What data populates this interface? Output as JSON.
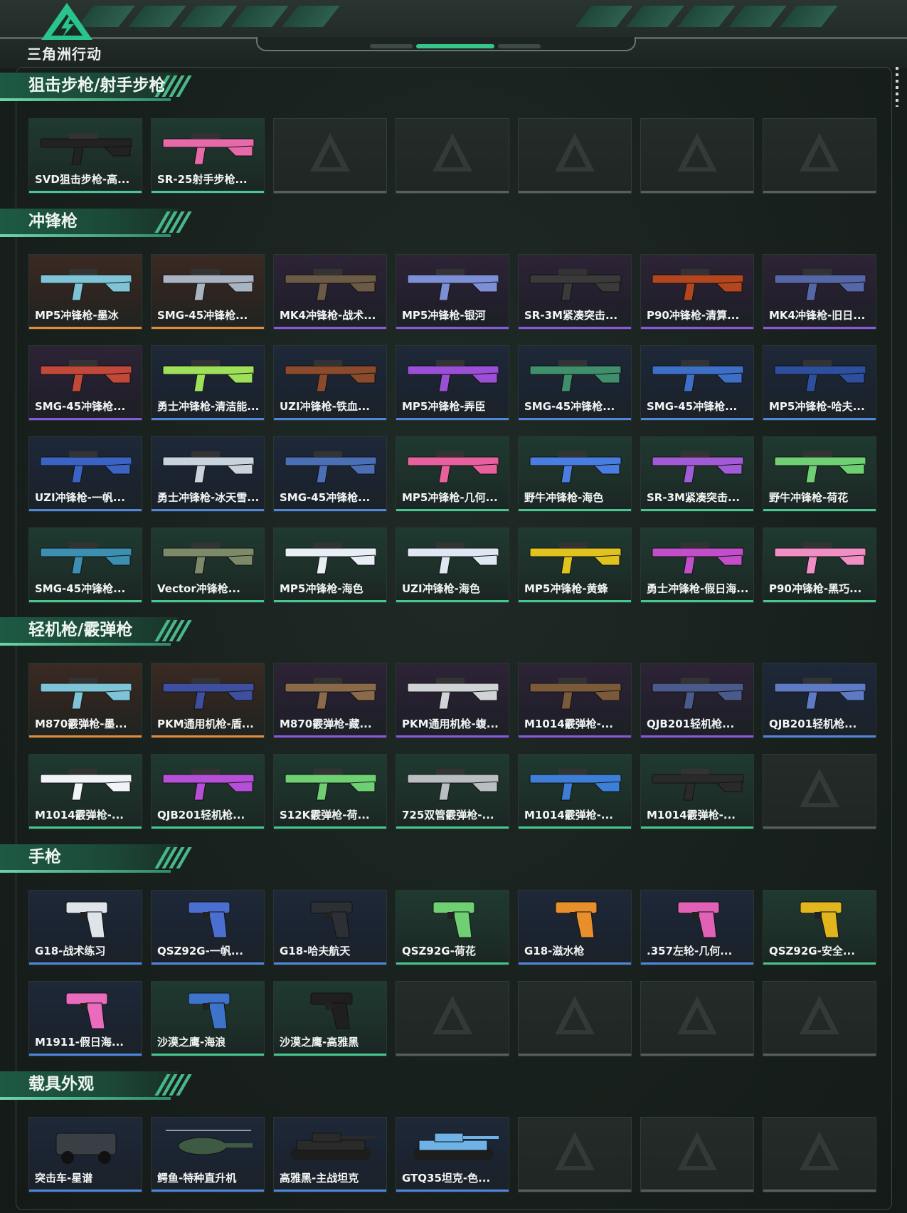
{
  "app": {
    "logo_text": "三角洲行动"
  },
  "colors": {
    "orange": "#e48a3b",
    "purple": "#8b56e0",
    "blue": "#4f86df",
    "green": "#43c98d"
  },
  "sections": [
    {
      "title": "狙击步枪/射手步枪",
      "rows": [
        [
          {
            "label": "SVD狙击步枪-高...",
            "rarity": "green",
            "icon": "sniper-rifle-icon",
            "hue": "#222"
          },
          {
            "label": "SR-25射手步枪...",
            "rarity": "green",
            "icon": "marksman-rifle-icon",
            "hue": "#e66aa8"
          },
          null,
          null,
          null,
          null,
          null
        ]
      ]
    },
    {
      "title": "冲锋枪",
      "rows": [
        [
          {
            "label": "MP5冲锋枪-墨冰",
            "rarity": "orange",
            "icon": "smg-icon",
            "hue": "#7fc4d6"
          },
          {
            "label": "SMG-45冲锋枪...",
            "rarity": "orange",
            "icon": "smg-icon",
            "hue": "#aab3c2"
          },
          {
            "label": "MK4冲锋枪-战术...",
            "rarity": "purple",
            "icon": "smg-icon",
            "hue": "#6b5a45"
          },
          {
            "label": "MP5冲锋枪-银河",
            "rarity": "purple",
            "icon": "smg-icon",
            "hue": "#7d8fd6"
          },
          {
            "label": "SR-3M紧凑突击...",
            "rarity": "purple",
            "icon": "smg-icon",
            "hue": "#3a3a3a"
          },
          {
            "label": "P90冲锋枪-清算...",
            "rarity": "purple",
            "icon": "smg-icon",
            "hue": "#b3451f"
          },
          {
            "label": "MK4冲锋枪-旧日...",
            "rarity": "purple",
            "icon": "smg-icon",
            "hue": "#5667a8"
          }
        ],
        [
          {
            "label": "SMG-45冲锋枪...",
            "rarity": "purple",
            "icon": "smg-icon",
            "hue": "#c2483a"
          },
          {
            "label": "勇士冲锋枪-清洁能...",
            "rarity": "blue",
            "icon": "smg-icon",
            "hue": "#9ee05a"
          },
          {
            "label": "UZI冲锋枪-铁血...",
            "rarity": "blue",
            "icon": "smg-icon",
            "hue": "#8a4a2b"
          },
          {
            "label": "MP5冲锋枪-弄臣",
            "rarity": "blue",
            "icon": "smg-icon",
            "hue": "#9b4fd6"
          },
          {
            "label": "SMG-45冲锋枪...",
            "rarity": "blue",
            "icon": "smg-icon",
            "hue": "#3f8f6d"
          },
          {
            "label": "SMG-45冲锋枪...",
            "rarity": "blue",
            "icon": "smg-icon",
            "hue": "#3d6fc7"
          },
          {
            "label": "MP5冲锋枪-哈夫...",
            "rarity": "blue",
            "icon": "smg-icon",
            "hue": "#2e4f9e"
          }
        ],
        [
          {
            "label": "UZI冲锋枪-一帆...",
            "rarity": "blue",
            "icon": "smg-icon",
            "hue": "#3b63c4"
          },
          {
            "label": "勇士冲锋枪-冰天雪...",
            "rarity": "blue",
            "icon": "smg-icon",
            "hue": "#c9d3dc"
          },
          {
            "label": "SMG-45冲锋枪...",
            "rarity": "blue",
            "icon": "smg-icon",
            "hue": "#4a6fb5"
          },
          {
            "label": "MP5冲锋枪-几何...",
            "rarity": "green",
            "icon": "smg-icon",
            "hue": "#e8619f"
          },
          {
            "label": "野牛冲锋枪-海色",
            "rarity": "green",
            "icon": "smg-icon",
            "hue": "#4a7de0"
          },
          {
            "label": "SR-3M紧凑突击...",
            "rarity": "green",
            "icon": "smg-icon",
            "hue": "#a15bd6"
          },
          {
            "label": "野牛冲锋枪-荷花",
            "rarity": "green",
            "icon": "smg-icon",
            "hue": "#6fcf73"
          }
        ],
        [
          {
            "label": "SMG-45冲锋枪...",
            "rarity": "green",
            "icon": "smg-icon",
            "hue": "#3c8fb0"
          },
          {
            "label": "Vector冲锋枪...",
            "rarity": "green",
            "icon": "smg-icon",
            "hue": "#7d8a6a"
          },
          {
            "label": "MP5冲锋枪-海色",
            "rarity": "green",
            "icon": "smg-icon",
            "hue": "#e8eef5"
          },
          {
            "label": "UZI冲锋枪-海色",
            "rarity": "green",
            "icon": "smg-icon",
            "hue": "#dfe7f2"
          },
          {
            "label": "MP5冲锋枪-黄蜂",
            "rarity": "green",
            "icon": "smg-icon",
            "hue": "#e0c31e"
          },
          {
            "label": "勇士冲锋枪-假日海...",
            "rarity": "green",
            "icon": "smg-icon",
            "hue": "#c24fc9"
          },
          {
            "label": "P90冲锋枪-黑巧...",
            "rarity": "green",
            "icon": "smg-icon",
            "hue": "#ef8fc4"
          }
        ]
      ]
    },
    {
      "title": "轻机枪/霰弹枪",
      "rows": [
        [
          {
            "label": "M870霰弹枪-墨...",
            "rarity": "orange",
            "icon": "shotgun-icon",
            "hue": "#7fc4d6"
          },
          {
            "label": "PKM通用机枪-盾...",
            "rarity": "orange",
            "icon": "lmg-icon",
            "hue": "#3d4f9e"
          },
          {
            "label": "M870霰弹枪-藏...",
            "rarity": "purple",
            "icon": "shotgun-icon",
            "hue": "#8a6a4a"
          },
          {
            "label": "PKM通用机枪-蝮...",
            "rarity": "purple",
            "icon": "lmg-icon",
            "hue": "#cfd3d6"
          },
          {
            "label": "M1014霰弹枪-...",
            "rarity": "purple",
            "icon": "shotgun-icon",
            "hue": "#7a5a3a"
          },
          {
            "label": "QJB201轻机枪...",
            "rarity": "purple",
            "icon": "lmg-icon",
            "hue": "#4a5a8a"
          },
          {
            "label": "QJB201轻机枪...",
            "rarity": "blue",
            "icon": "lmg-icon",
            "hue": "#5f7ac4"
          }
        ],
        [
          {
            "label": "M1014霰弹枪-...",
            "rarity": "green",
            "icon": "shotgun-icon",
            "hue": "#f0f3f7"
          },
          {
            "label": "QJB201轻机枪...",
            "rarity": "green",
            "icon": "lmg-icon",
            "hue": "#b54fd6"
          },
          {
            "label": "S12K霰弹枪-荷...",
            "rarity": "green",
            "icon": "shotgun-icon",
            "hue": "#6fcf73"
          },
          {
            "label": "725双管霰弹枪-...",
            "rarity": "green",
            "icon": "shotgun-icon",
            "hue": "#b8bec2"
          },
          {
            "label": "M1014霰弹枪-...",
            "rarity": "green",
            "icon": "shotgun-icon",
            "hue": "#3d7fd6"
          },
          {
            "label": "M1014霰弹枪-...",
            "rarity": "green",
            "icon": "shotgun-icon",
            "hue": "#2a2a2a"
          },
          null
        ]
      ]
    },
    {
      "title": "手枪",
      "rows": [
        [
          {
            "label": "G18-战术练习",
            "rarity": "blue",
            "icon": "pistol-icon",
            "hue": "#dfe4ea"
          },
          {
            "label": "QSZ92G-一帆...",
            "rarity": "blue",
            "icon": "pistol-icon",
            "hue": "#4a6fd0"
          },
          {
            "label": "G18-哈夫航天",
            "rarity": "blue",
            "icon": "pistol-icon",
            "hue": "#2c2f33"
          },
          {
            "label": "QSZ92G-荷花",
            "rarity": "green",
            "icon": "pistol-icon",
            "hue": "#6fcf73"
          },
          {
            "label": "G18-滋水枪",
            "rarity": "blue",
            "icon": "pistol-icon",
            "hue": "#e88f2c"
          },
          {
            "label": ".357左轮-几何...",
            "rarity": "blue",
            "icon": "revolver-icon",
            "hue": "#e061b5"
          },
          {
            "label": "QSZ92G-安全...",
            "rarity": "green",
            "icon": "pistol-icon",
            "hue": "#e0b51e"
          }
        ],
        [
          {
            "label": "M1911-假日海...",
            "rarity": "blue",
            "icon": "pistol-icon",
            "hue": "#e86bbd"
          },
          {
            "label": "沙漠之鹰-海浪",
            "rarity": "green",
            "icon": "pistol-icon",
            "hue": "#3d74c9"
          },
          {
            "label": "沙漠之鹰-高雅黑",
            "rarity": "green",
            "icon": "pistol-icon",
            "hue": "#1f1f1f"
          },
          null,
          null,
          null,
          null
        ]
      ]
    },
    {
      "title": "载具外观",
      "rows": [
        [
          {
            "label": "突击车-星谱",
            "rarity": "blue",
            "icon": "assault-vehicle-icon",
            "hue": "#3a3f45"
          },
          {
            "label": "鳄鱼-特种直升机",
            "rarity": "blue",
            "icon": "helicopter-icon",
            "hue": "#3f5a44"
          },
          {
            "label": "高雅黑-主战坦克",
            "rarity": "blue",
            "icon": "tank-icon",
            "hue": "#2a2a2a"
          },
          {
            "label": "GTQ35坦克-色...",
            "rarity": "blue",
            "icon": "tank-icon",
            "hue": "#6fb3e6"
          },
          null,
          null,
          null
        ]
      ]
    }
  ]
}
